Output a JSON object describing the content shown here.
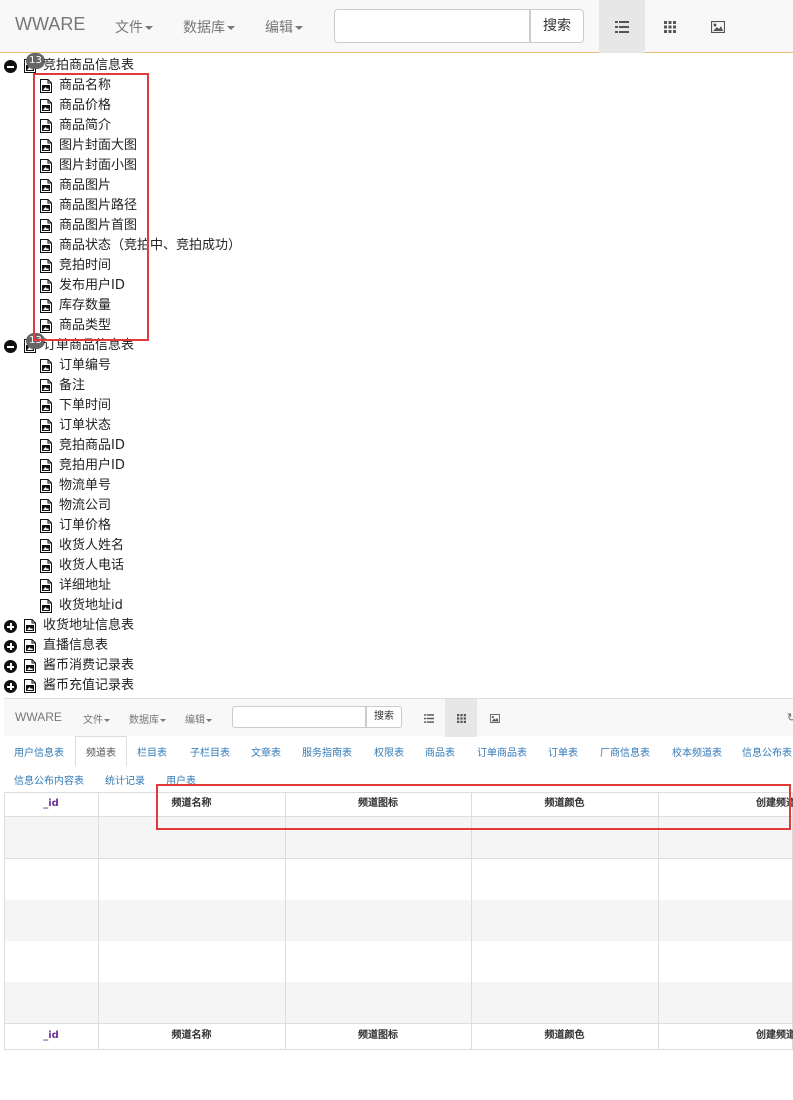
{
  "navbar": {
    "brand": "WWARE",
    "menus": [
      "文件",
      "数据库",
      "编辑"
    ],
    "search_button": "搜索",
    "search_value": "",
    "view_icons": [
      "list-view-icon",
      "grid-view-icon",
      "image-view-icon"
    ]
  },
  "tree": {
    "groups": [
      {
        "label": "竞拍商品信息表",
        "count": "13",
        "expanded": true,
        "children": [
          "商品名称",
          "商品价格",
          "商品简介",
          "图片封面大图",
          "图片封面小图",
          "商品图片",
          "商品图片路径",
          "商品图片首图",
          "商品状态（竞拍中、竞拍成功）",
          "竞拍时间",
          "发布用户ID",
          "库存数量",
          "商品类型"
        ]
      },
      {
        "label": "订单商品信息表",
        "count": "13",
        "expanded": true,
        "children": [
          "订单编号",
          "备注",
          "下单时间",
          "订单状态",
          "竞拍商品ID",
          "竞拍用户ID",
          "物流单号",
          "物流公司",
          "订单价格",
          "收货人姓名",
          "收货人电话",
          "详细地址",
          "收货地址id"
        ]
      },
      {
        "label": "收货地址信息表",
        "expanded": false
      },
      {
        "label": "直播信息表",
        "expanded": false
      },
      {
        "label": "酱币消费记录表",
        "expanded": false
      },
      {
        "label": "酱币充值记录表",
        "expanded": false
      }
    ]
  },
  "sub_app": {
    "brand": "WWARE",
    "menus": [
      "文件",
      "数据库",
      "编辑"
    ],
    "search_button": "搜索",
    "tabs": [
      "用户信息表",
      "频道表",
      "栏目表",
      "子栏目表",
      "文章表",
      "服务指南表",
      "权限表",
      "商品表",
      "订单商品表",
      "订单表",
      "厂商信息表",
      "校本频道表",
      "信息公布表",
      "信息公布内容表",
      "统计记录",
      "用户表"
    ],
    "active_tab": "频道表",
    "columns": [
      "_id",
      "频道名称",
      "频道图标",
      "频道颜色",
      "创建频道"
    ]
  },
  "colors": {
    "highlight": "#e23a3a",
    "link": "#337ab7",
    "id_column": "#7030a0"
  }
}
